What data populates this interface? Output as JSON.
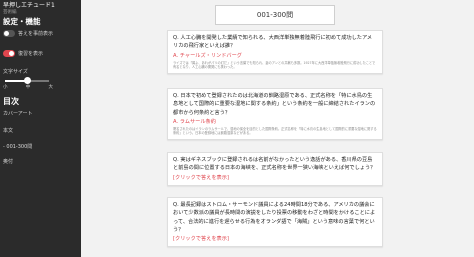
{
  "sidebar": {
    "app_title": "早押しエチュード1",
    "app_subtitle": "芸術編",
    "settings_title": "設定・機能",
    "toggle_answers_label": "答えを事前表示",
    "toggle_review_label": "復習を表示",
    "font_size_label": "文字サイズ",
    "font_size_ticks": [
      "小",
      "中",
      "大"
    ],
    "font_size_level": 0.5,
    "toc_title": "目次",
    "toc_items": [
      "カバーアート",
      "本文",
      "- 001-300問",
      "奥付"
    ]
  },
  "main": {
    "header": "001-300問",
    "questions": [
      {
        "question": "Q. 人工心臓を開発した業績で知られる、大西洋単独無着陸飛行に初めて成功したアメリカの飛行家といえば誰？",
        "answer": "A. チャールズ・リンドバーグ",
        "explanation": "ライズでは「翼よ、あれがパリの灯だ」という言葉でも知られ、妻のアンとの共著も多数。1927年に大西洋単独無着陸飛行に成功したことで有名となり、人工心臓の開発にも携わった。"
      },
      {
        "question": "Q. 日本で初めて登録されたのは北海道の釧路湿原である、正式名称を「特に水鳥の生息地として国際的に重要な湿地に関する条約」という条約を一般に締結されたイランの都市から何条約と言う？",
        "answer": "A. ラムサール条約",
        "explanation": "署名されたのはイランのラムサールで、湿地の保全を目的とした国際条約。正式名称を「特に水鳥の生息地として国際的に重要な湿地に関する条約」という。日本の登録地には釧路湿原などがある。"
      },
      {
        "question": "Q. 実はギネスブックに登録されるは名前がなかったという逸話がある、香川県の豆島と前島の間に位置する日本の海峡を、正式名称を世界一狭い海峡といえば何でしょう？",
        "reveal_label": "[クリックで答えを表示]"
      },
      {
        "question": "Q. 最長記録はストロム・サーモンド議員による24時間18分である、アメリカの議会において少数派の議員が長時間の演説をしたり投票の移動をわざと時間をかけることによって、合法的に進行を遅らせる行為をオランダ語で「海賊」という意味の言葉で何という？",
        "reveal_label": "[クリックで答えを表示]"
      }
    ]
  },
  "colors": {
    "sidebar_bg": "#2b2b2b",
    "accent": "#e0464e",
    "page_bg": "#f2f2f2"
  }
}
